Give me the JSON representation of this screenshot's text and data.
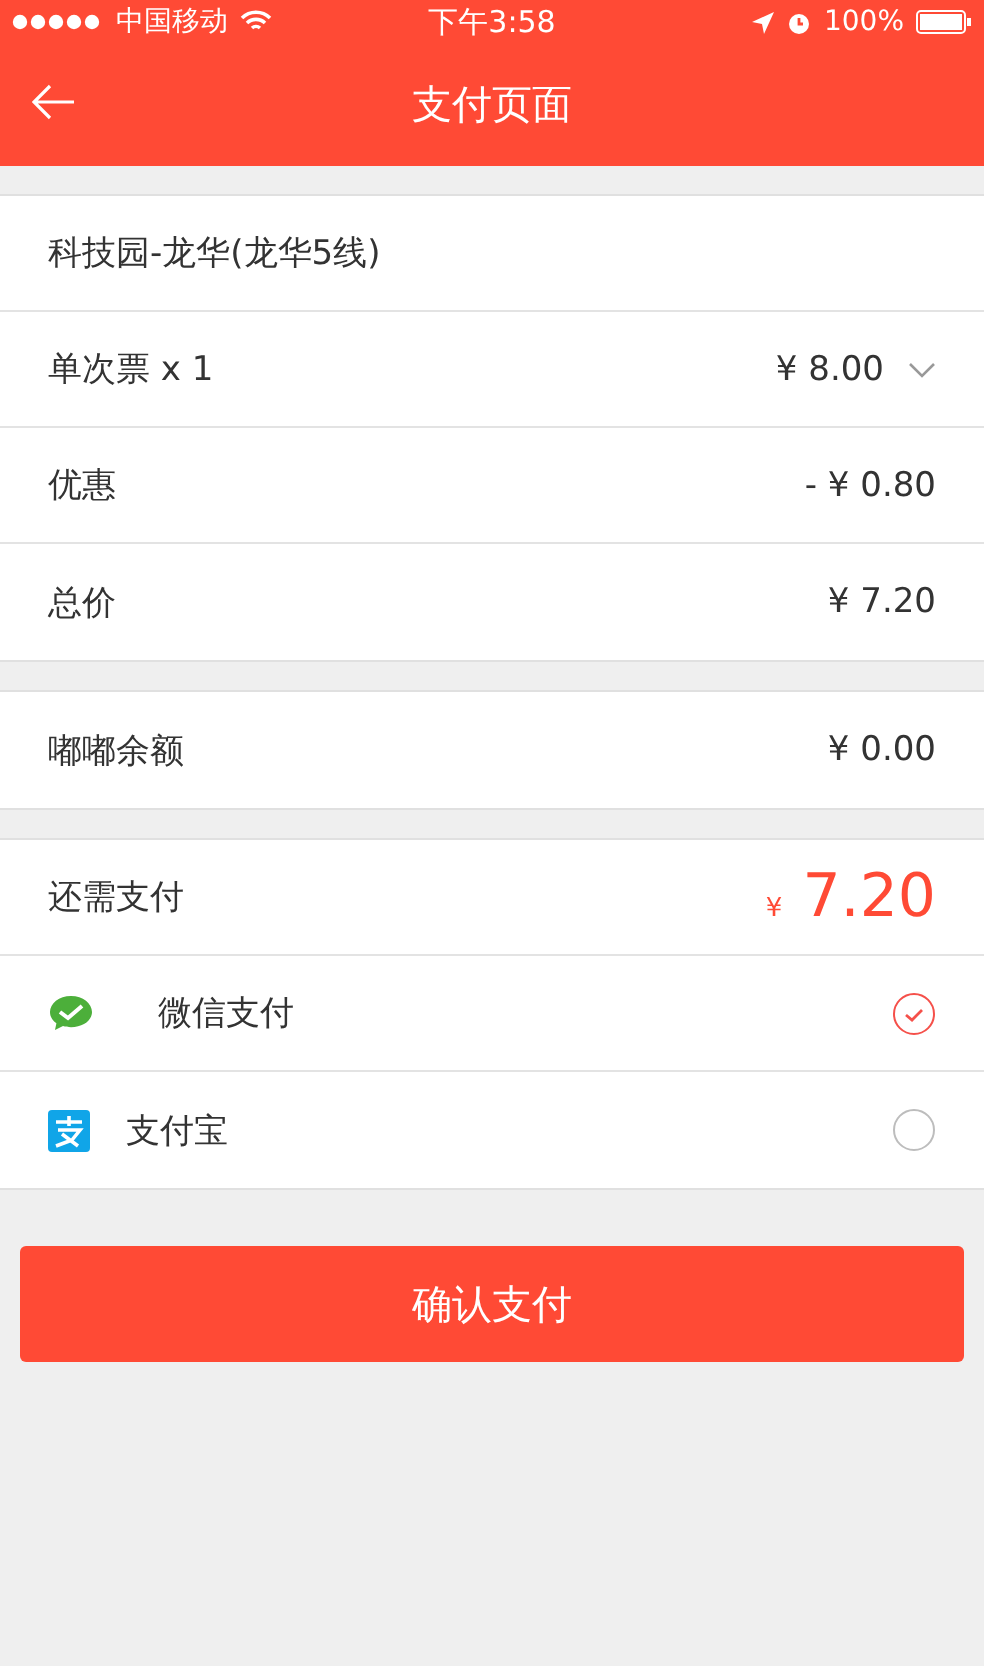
{
  "status_bar": {
    "carrier": "中国移动",
    "time": "下午3:58",
    "battery": "100%"
  },
  "nav": {
    "title": "支付页面"
  },
  "order": [
    {
      "kind": "text",
      "label": "科技园-龙华(龙华5线)"
    },
    {
      "kind": "dropdown",
      "label": "单次票 x 1",
      "value": "¥ 8.00"
    },
    {
      "kind": "value",
      "label": "优惠",
      "value": "- ¥ 0.80"
    },
    {
      "kind": "value",
      "label": "总价",
      "value": "¥ 7.20"
    }
  ],
  "balance": {
    "label": "嘟嘟余额",
    "value": "¥ 0.00"
  },
  "due": {
    "label": "还需支付",
    "currency": "¥",
    "amount": "7.20"
  },
  "methods": [
    {
      "kind": "wechat",
      "label": "微信支付",
      "selected": true
    },
    {
      "kind": "alipay",
      "label": "支付宝",
      "selected": false
    }
  ],
  "confirm": "确认支付"
}
